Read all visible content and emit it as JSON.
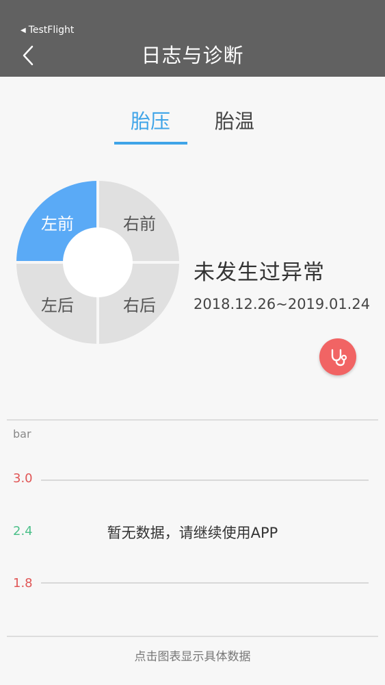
{
  "statusbar": {
    "back_app": "TestFlight"
  },
  "navbar": {
    "title": "日志与诊断"
  },
  "tabs": [
    {
      "label": "胎压",
      "active": true
    },
    {
      "label": "胎温",
      "active": false
    }
  ],
  "wheel": {
    "quadrants": [
      {
        "label": "左前",
        "selected": true
      },
      {
        "label": "右前",
        "selected": false
      },
      {
        "label": "左后",
        "selected": false
      },
      {
        "label": "右后",
        "selected": false
      }
    ],
    "selected_color": "#5aaaf6",
    "unselected_color": "#e0e0e0"
  },
  "status": {
    "title": "未发生过异常",
    "date_range": "2018.12.26~2019.01.24"
  },
  "diagnose_button": {
    "icon": "stethoscope-icon",
    "color": "#f16464"
  },
  "chart": {
    "unit": "bar",
    "ticks": [
      {
        "label": "3.0",
        "color": "#e05555"
      },
      {
        "label": "2.4",
        "color": "#4cc08a"
      },
      {
        "label": "1.8",
        "color": "#e05555"
      }
    ],
    "empty_message": "暂无数据，请继续使用APP"
  },
  "footer": {
    "hint": "点击图表显示具体数据"
  }
}
